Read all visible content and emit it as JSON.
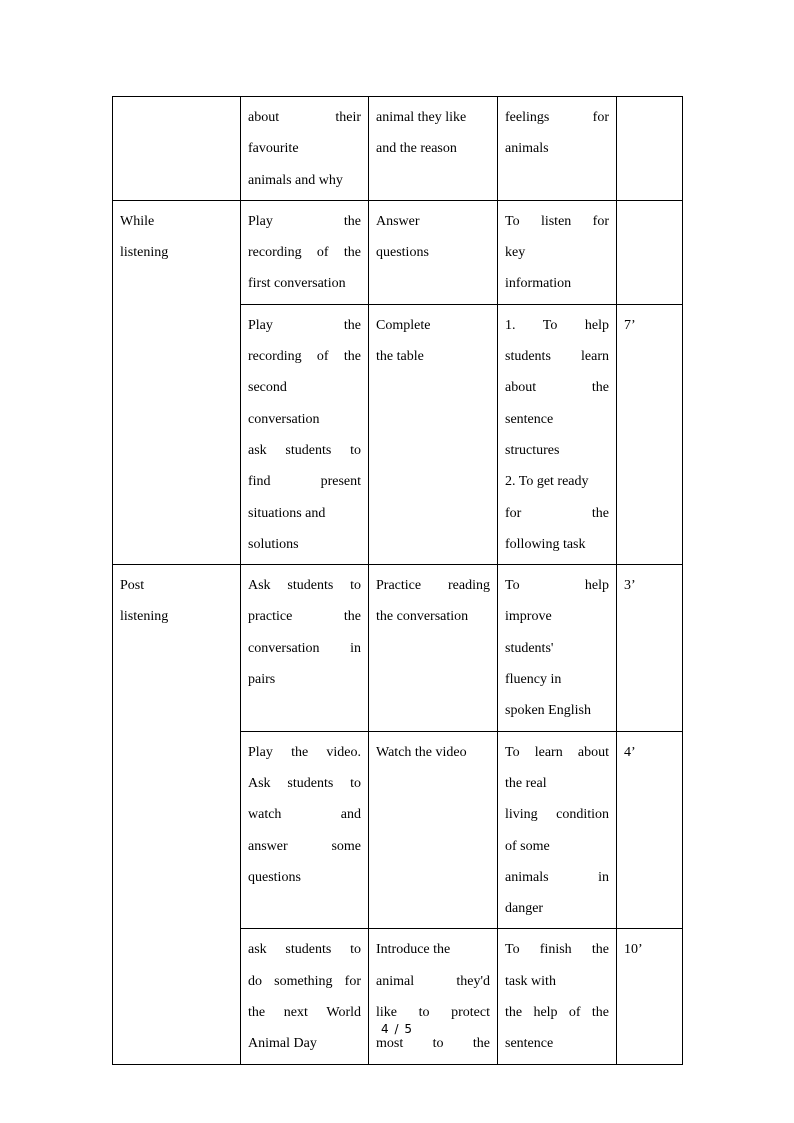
{
  "document": {
    "footer": {
      "page_indicator": "4 / 5"
    }
  },
  "table": {
    "rows": [
      {
        "stage": [],
        "teacher": [
          "about their",
          "favourite",
          "animals and why"
        ],
        "students": [
          "animal they like",
          "and the reason"
        ],
        "purpose": [
          "feelings for",
          "animals"
        ],
        "time": ""
      },
      {
        "stage": [
          "While",
          "listening"
        ],
        "teacher": [
          "Play the",
          "recording of the",
          "first conversation"
        ],
        "students": [
          "Answer",
          "questions"
        ],
        "purpose": [
          "To listen for",
          "key",
          "information"
        ],
        "time": ""
      },
      {
        "stage": [],
        "teacher": [
          "Play the",
          "recording of the",
          "second",
          "conversation",
          "ask students to",
          "find present",
          "situations and",
          "solutions"
        ],
        "students": [
          "Complete",
          "the table"
        ],
        "purpose": [
          "1. To help",
          "students learn",
          "about the",
          "sentence",
          "structures",
          "2. To get ready",
          "for the",
          "following task"
        ],
        "time": "7’"
      },
      {
        "stage": [
          "Post",
          "listening"
        ],
        "teacher": [
          "Ask students to",
          "practice the",
          "conversation in",
          "pairs"
        ],
        "students": [
          "Practice reading",
          "the conversation"
        ],
        "purpose": [
          "To help",
          "improve",
          "students'",
          "fluency in",
          "spoken English"
        ],
        "time": "3’"
      },
      {
        "stage": [],
        "teacher": [
          "Play the video.",
          "Ask students to",
          "watch and",
          "answer some",
          "questions"
        ],
        "students": [
          "Watch the video"
        ],
        "purpose": [
          "To learn about",
          "the real",
          "living condition",
          "of some",
          "animals in",
          "danger"
        ],
        "time": "4’"
      },
      {
        "stage": [],
        "teacher": [
          "ask students to",
          "do something for",
          "the next World",
          "Animal Day"
        ],
        "students": [
          "Introduce the",
          "animal they'd",
          "like to protect",
          "most to the"
        ],
        "purpose": [
          "To finish the",
          "task with",
          "the help of the",
          "sentence"
        ],
        "time": "10’"
      }
    ]
  }
}
